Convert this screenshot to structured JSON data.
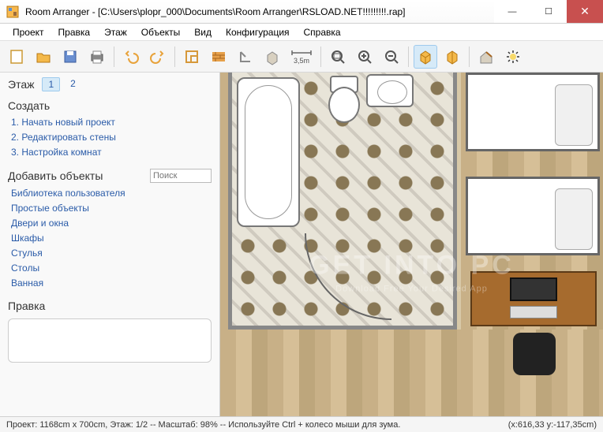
{
  "window": {
    "title": "Room Arranger - [C:\\Users\\plopr_000\\Documents\\Room Arranger\\RSLOAD.NET!!!!!!!!!.rap]"
  },
  "menu": [
    "Проект",
    "Правка",
    "Этаж",
    "Объекты",
    "Вид",
    "Конфигурация",
    "Справка"
  ],
  "sidebar": {
    "floor": {
      "label": "Этаж",
      "tabs": [
        "1",
        "2"
      ],
      "active": 0
    },
    "create": {
      "label": "Создать",
      "items": [
        "Начать новый проект",
        "Редактировать стены",
        "Настройка комнат"
      ]
    },
    "add": {
      "label": "Добавить объекты",
      "search_placeholder": "Поиск",
      "items": [
        "Библиотека пользователя",
        "Простые объекты",
        "Двери и окна",
        "Шкафы",
        "Стулья",
        "Столы",
        "Ванная"
      ]
    },
    "edit": {
      "label": "Правка"
    }
  },
  "toolbar": {
    "measure_label": "3,5m"
  },
  "watermark": {
    "line1": "GET INTO PC",
    "line2": "Download Free Your Desired App"
  },
  "status": {
    "left": "Проект: 1168cm x 700cm, Этаж: 1/2 -- Масштаб: 98% -- Используйте Ctrl + колесо мыши для зума.",
    "right": "(x:616,33 y:-117,35cm)"
  }
}
